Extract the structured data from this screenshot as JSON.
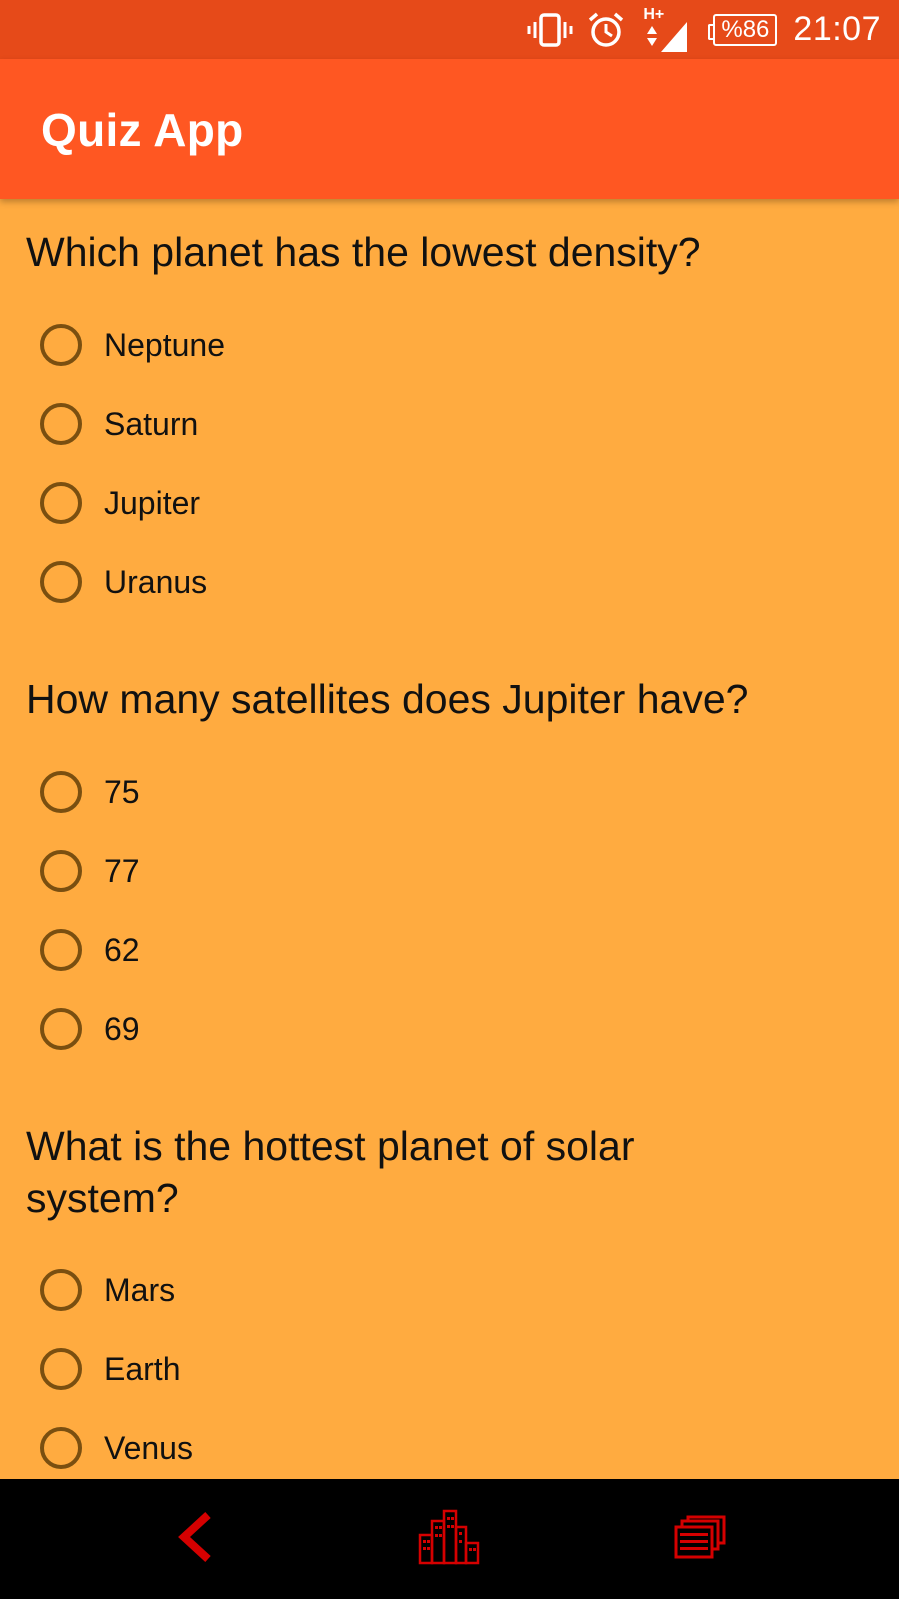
{
  "status_bar": {
    "network_label": "H+",
    "battery": "%86",
    "time": "21:07"
  },
  "app_bar": {
    "title": "Quiz App"
  },
  "questions": [
    {
      "text": "Which planet has the lowest density?",
      "options": [
        "Neptune",
        "Saturn",
        "Jupiter",
        "Uranus"
      ]
    },
    {
      "text": "How many satellites does Jupiter have?",
      "options": [
        "75",
        "77",
        "62",
        "69"
      ]
    },
    {
      "text": "What is the hottest planet of solar system?",
      "options": [
        "Mars",
        "Earth",
        "Venus"
      ]
    }
  ],
  "colors": {
    "status_bar": "#E64A19",
    "app_bar": "#FF5722",
    "background": "#FFAB40",
    "radio_outline": "#7A4F10",
    "nav_icons": "#D50000"
  }
}
